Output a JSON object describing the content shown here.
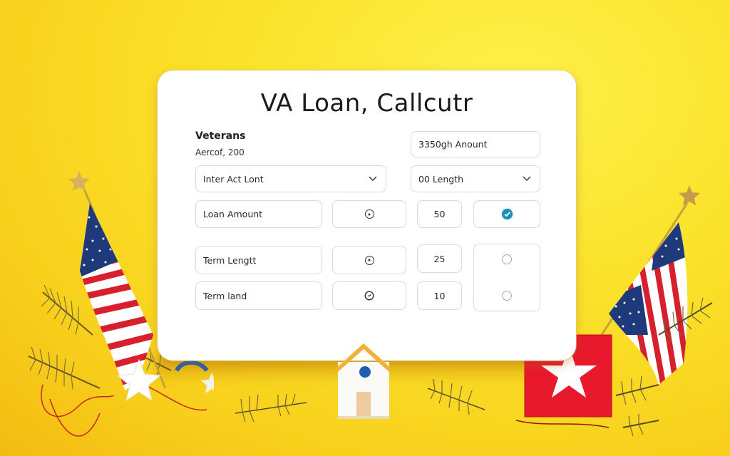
{
  "calculator": {
    "title": "VA Loan, Callcutr",
    "section_label": "Veterans",
    "section_sub": "Aercof, 200",
    "top_right_input": {
      "value": "3350gh Anount"
    },
    "dropdowns": [
      {
        "value": "Inter Act Lont",
        "icon": "chevron-down-icon"
      },
      {
        "value": "00 Length",
        "icon": "chevron-down-icon"
      }
    ],
    "rows": [
      {
        "label": "Loan Amount",
        "radio_icon": "radio-selected-icon",
        "value": "50",
        "checked": true
      },
      {
        "label": "Term Lengtt",
        "radio_icon": "radio-selected-icon",
        "value": "25",
        "checked": false
      },
      {
        "label": "Term land",
        "radio_icon": "clock-icon",
        "value": "10",
        "checked": false
      }
    ]
  },
  "decorations": {
    "left": [
      "us-flag",
      "gold-star",
      "white-star",
      "small-white-star",
      "pine-branch",
      "red-string",
      "blue-ribbon"
    ],
    "center": [
      "house-figurine"
    ],
    "right": [
      "us-flag",
      "gold-star",
      "red-star-box",
      "pine-branch"
    ]
  },
  "colors": {
    "background": "#fbe22a",
    "accent_check": "#1b8fb4",
    "flag_red": "#d6202e",
    "flag_blue": "#1f3a7a",
    "box_red": "#e8192c"
  }
}
